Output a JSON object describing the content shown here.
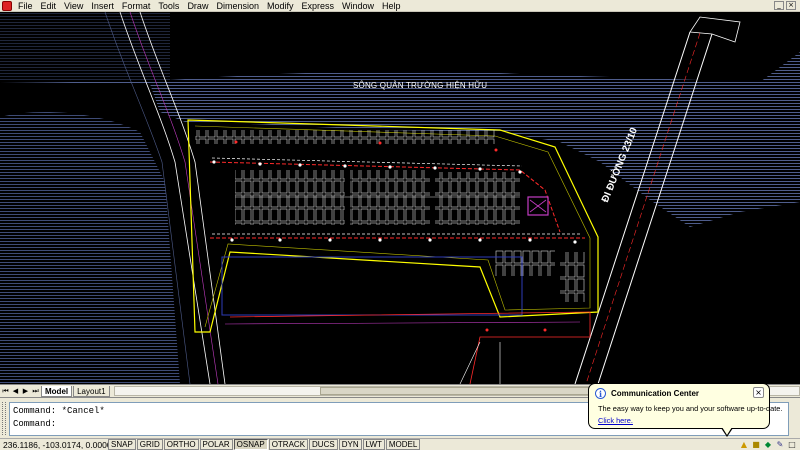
{
  "menu": {
    "items": [
      "File",
      "Edit",
      "View",
      "Insert",
      "Format",
      "Tools",
      "Draw",
      "Dimension",
      "Modify",
      "Express",
      "Window",
      "Help"
    ],
    "window_buttons": [
      "_",
      "×"
    ]
  },
  "drawing": {
    "river_label": "SÔNG QUẢN TRƯỜNG HIỆN HỮU",
    "road_label": "ĐI ĐƯỜNG 23/10",
    "colors": {
      "background": "#000000",
      "hatch": "#4f5d8c",
      "boundary": "#ffff00",
      "road_red": "#ff2a2a",
      "white_lines": "#ffffff",
      "magenta": "#c33cc3"
    }
  },
  "layout_tabs": {
    "nav_arrows": [
      "⏮",
      "◀",
      "▶",
      "⏭"
    ],
    "tabs": [
      "Model",
      "Layout1"
    ],
    "active": "Model"
  },
  "command": {
    "lines": [
      "Command: *Cancel*",
      "Command:"
    ]
  },
  "status": {
    "coords": "236.1186, -103.0174, 0.0000",
    "toggles": [
      "SNAP",
      "GRID",
      "ORTHO",
      "POLAR",
      "OSNAP",
      "OTRACK",
      "DUCS",
      "DYN",
      "LWT",
      "MODEL"
    ],
    "tray_icons": [
      "comm-center-icon",
      "lock-icon",
      "network-icon",
      "pen-icon",
      "clean-screen-icon"
    ]
  },
  "balloon": {
    "title": "Communication Center",
    "message": "The easy way to keep you and your software up-to-date.",
    "link": "Click here."
  }
}
